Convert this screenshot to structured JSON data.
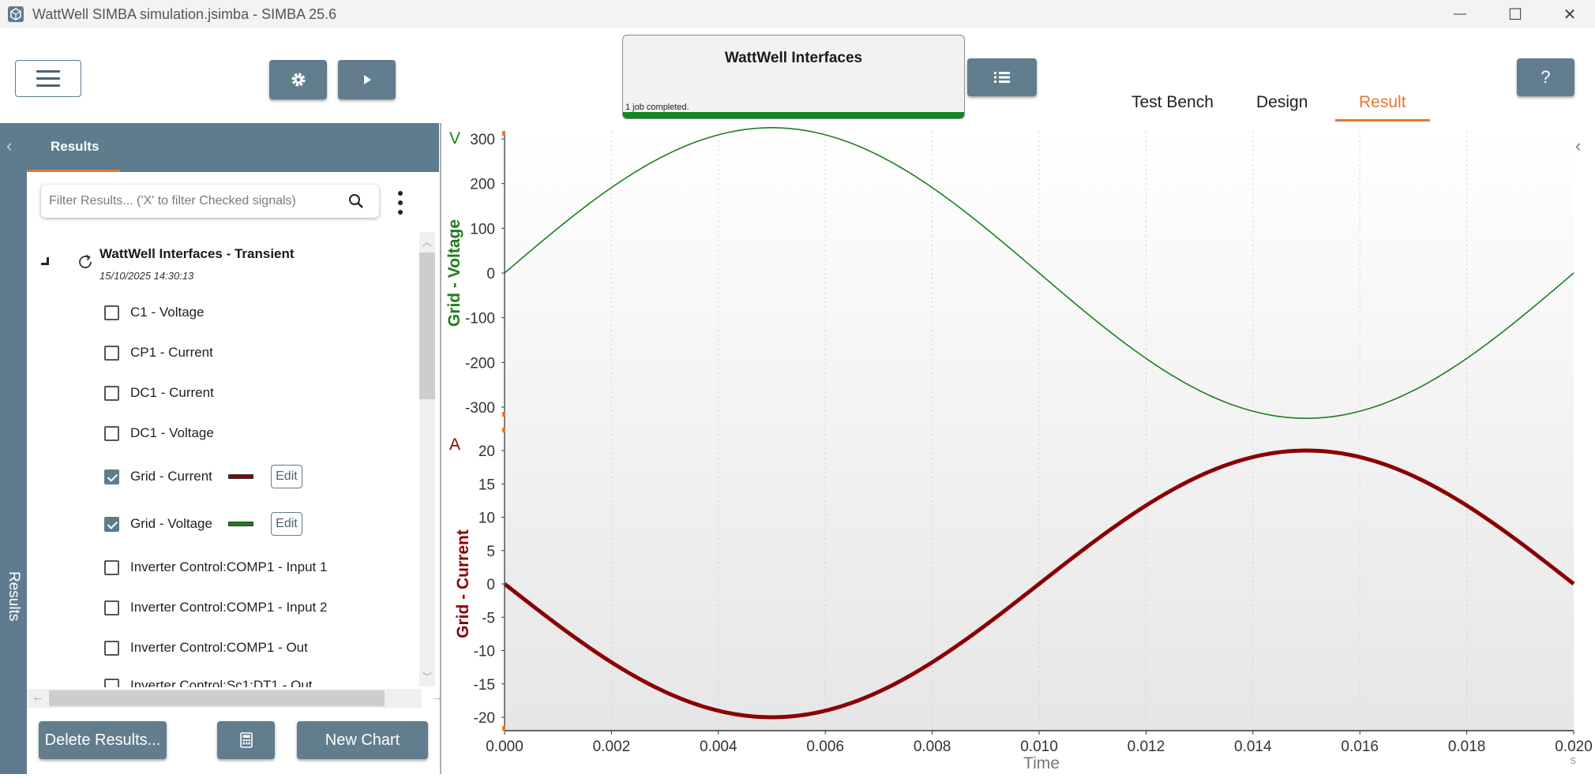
{
  "window": {
    "title": "WattWell SIMBA simulation.jsimba - SIMBA 25.6",
    "minimize": "—",
    "maximize": "☐",
    "close": "✕"
  },
  "toolbar": {
    "job": {
      "title": "WattWell Interfaces",
      "status": "1 job completed.",
      "progress": 1.0
    },
    "help_label": "?"
  },
  "tabs": [
    {
      "label": "Test Bench",
      "active": false
    },
    {
      "label": "Design",
      "active": false
    },
    {
      "label": "Result",
      "active": true
    }
  ],
  "sidebar": {
    "strip_label": "Results",
    "tab_label": "Results",
    "filter_placeholder": "Filter Results... ('X' to filter Checked signals)",
    "simulation": {
      "name": "WattWell Interfaces - Transient",
      "date": "15/10/2025 14:30:13"
    },
    "signals": [
      {
        "label": "C1 - Voltage",
        "checked": false
      },
      {
        "label": "CP1 - Current",
        "checked": false
      },
      {
        "label": "DC1 - Current",
        "checked": false
      },
      {
        "label": "DC1 - Voltage",
        "checked": false
      },
      {
        "label": "Grid - Current",
        "checked": true,
        "color": "#8b0000",
        "edit": "Edit"
      },
      {
        "label": "Grid - Voltage",
        "checked": true,
        "color": "#1e7d1e",
        "edit": "Edit"
      },
      {
        "label": "Inverter Control:COMP1 - Input 1",
        "checked": false
      },
      {
        "label": "Inverter Control:COMP1 - Input 2",
        "checked": false
      },
      {
        "label": "Inverter Control:COMP1 - Out",
        "checked": false
      },
      {
        "label": "Inverter Control:Sc1:DT1 - Out",
        "checked": false
      }
    ],
    "buttons": {
      "delete": "Delete Results...",
      "new_chart": "New Chart"
    }
  },
  "colors": {
    "accent": "#e8772e",
    "panel": "#5f7c8e",
    "voltage": "#1e7d1e",
    "current": "#8b0000"
  },
  "chart_data": [
    {
      "type": "line",
      "ylabel": "Grid - Voltage",
      "unit": "V",
      "ylim": [
        -325,
        325
      ],
      "yticks": [
        300,
        200,
        100,
        0,
        -100,
        -200,
        -300
      ],
      "series": [
        {
          "name": "Grid - Voltage",
          "function": "sine",
          "amplitude": 325,
          "frequency_hz": 50,
          "phase": 0,
          "x_range": [
            0.0,
            0.02
          ]
        }
      ],
      "grid": true
    },
    {
      "type": "line",
      "ylabel": "Grid - Current",
      "unit": "A",
      "ylim": [
        -20,
        20
      ],
      "yticks": [
        20,
        15,
        10,
        5,
        0,
        -5,
        -10,
        -15,
        -20
      ],
      "series": [
        {
          "name": "Grid - Current",
          "function": "sine",
          "amplitude": -20,
          "frequency_hz": 50,
          "phase": 0,
          "x_range": [
            0.0,
            0.02
          ]
        }
      ],
      "grid": true
    }
  ],
  "x_axis": {
    "label": "Time",
    "unit": "s",
    "xlim": [
      0.0,
      0.02
    ],
    "ticks": [
      "0.000",
      "0.002",
      "0.004",
      "0.006",
      "0.008",
      "0.010",
      "0.012",
      "0.014",
      "0.016",
      "0.018",
      "0.020"
    ]
  }
}
